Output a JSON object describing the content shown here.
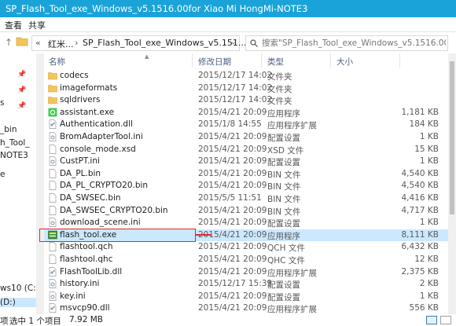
{
  "window": {
    "title": "SP_Flash_Tool_exe_Windows_v5.1516.00for Xiao Mi HongMi-NOTE3"
  },
  "ribbon": {
    "tabs": [
      "查看",
      "共享"
    ]
  },
  "address": {
    "crumbs": [
      "«",
      "红米...",
      "SP_Flash_Tool_exe_Windows_v5.151..."
    ]
  },
  "search": {
    "placeholder": "搜索\"SP_Flash_Tool_exe_Windows_v5.1516.00for Xiao ..."
  },
  "left_pane": {
    "items": [
      "s",
      "_bin",
      "h_Tool_",
      "NOTE3",
      "e",
      "ws10 (C:",
      "(D:)"
    ]
  },
  "columns": {
    "name": "名称",
    "date": "修改日期",
    "type": "类型",
    "size": "大小"
  },
  "files": [
    {
      "name": "codecs",
      "date": "2015/12/17 14:02",
      "type": "文件夹",
      "size": "",
      "icon": "folder-icon"
    },
    {
      "name": "imageformats",
      "date": "2015/12/17 14:02",
      "type": "文件夹",
      "size": "",
      "icon": "folder-icon"
    },
    {
      "name": "sqldrivers",
      "date": "2015/12/17 14:02",
      "type": "文件夹",
      "size": "",
      "icon": "folder-icon"
    },
    {
      "name": "assistant.exe",
      "date": "2015/4/21 20:09",
      "type": "应用程序",
      "size": "1,181 KB",
      "icon": "qt-app-icon"
    },
    {
      "name": "Authentication.dll",
      "date": "2015/1/8 14:55",
      "type": "应用程序扩展",
      "size": "184 KB",
      "icon": "dll-icon"
    },
    {
      "name": "BromAdapterTool.ini",
      "date": "2015/4/21 20:09",
      "type": "配置设置",
      "size": "1 KB",
      "icon": "ini-icon"
    },
    {
      "name": "console_mode.xsd",
      "date": "2015/4/21 20:09",
      "type": "XSD 文件",
      "size": "15 KB",
      "icon": "file-icon"
    },
    {
      "name": "CustPT.ini",
      "date": "2015/4/21 20:09",
      "type": "配置设置",
      "size": "1 KB",
      "icon": "ini-icon"
    },
    {
      "name": "DA_PL.bin",
      "date": "2015/4/21 20:09",
      "type": "BIN 文件",
      "size": "4,540 KB",
      "icon": "file-icon"
    },
    {
      "name": "DA_PL_CRYPTO20.bin",
      "date": "2015/4/21 20:09",
      "type": "BIN 文件",
      "size": "4,540 KB",
      "icon": "file-icon"
    },
    {
      "name": "DA_SWSEC.bin",
      "date": "2015/5/5 11:51",
      "type": "BIN 文件",
      "size": "4,416 KB",
      "icon": "file-icon"
    },
    {
      "name": "DA_SWSEC_CRYPTO20.bin",
      "date": "2015/4/21 20:09",
      "type": "BIN 文件",
      "size": "4,717 KB",
      "icon": "file-icon"
    },
    {
      "name": "download_scene.ini",
      "date": "2015/4/21 20:09",
      "type": "配置设置",
      "size": "1 KB",
      "icon": "ini-icon"
    },
    {
      "name": "flash_tool.exe",
      "date": "2015/4/21 20:09",
      "type": "应用程序",
      "size": "8,111 KB",
      "icon": "flash-tool-icon",
      "selected": true
    },
    {
      "name": "flashtool.qch",
      "date": "2015/4/21 20:09",
      "type": "QCH 文件",
      "size": "6,432 KB",
      "icon": "file-icon"
    },
    {
      "name": "flashtool.qhc",
      "date": "2015/4/21 20:09",
      "type": "QHC 文件",
      "size": "12 KB",
      "icon": "file-icon"
    },
    {
      "name": "FlashToolLib.dll",
      "date": "2015/4/21 20:09",
      "type": "应用程序扩展",
      "size": "2,375 KB",
      "icon": "dll-icon"
    },
    {
      "name": "history.ini",
      "date": "2015/12/17 15:39",
      "type": "配置设置",
      "size": "2 KB",
      "icon": "ini-icon"
    },
    {
      "name": "key.ini",
      "date": "2015/4/21 20:09",
      "type": "配置设置",
      "size": "1 KB",
      "icon": "ini-icon"
    },
    {
      "name": "msvcp90.dll",
      "date": "2015/4/21 20:09",
      "type": "应用程序扩展",
      "size": "556 KB",
      "icon": "dll-icon"
    }
  ],
  "status": {
    "selection": "选中 1 个项目",
    "size": "7.92 MB",
    "prefix": "项"
  },
  "colors": {
    "titlebar": "#1aa3d9",
    "selected_row": "#cce8ff",
    "highlight_box": "#e0252c",
    "folder": "#f2c55c"
  }
}
